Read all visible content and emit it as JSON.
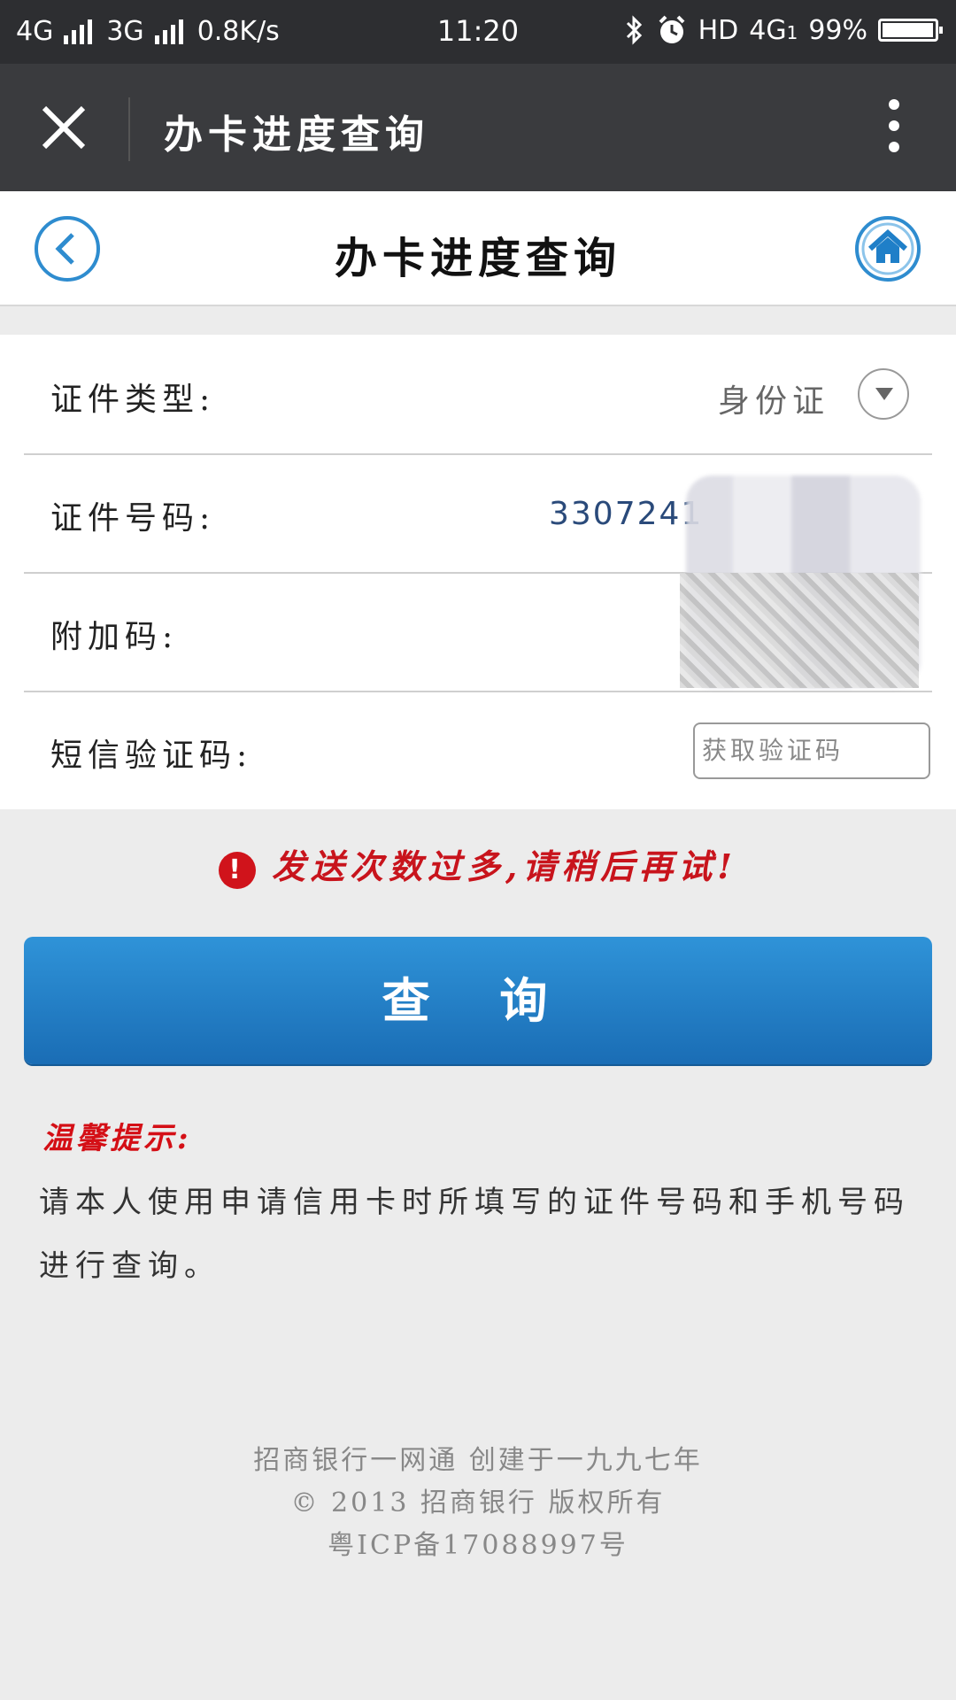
{
  "status_bar": {
    "net1": "4G",
    "net2": "3G",
    "speed": "0.8K/s",
    "time": "11:20",
    "hd": "HD",
    "net3": "4G",
    "sim": "1",
    "battery": "99%",
    "battery_level": 0.99
  },
  "titlebar": {
    "title": "办卡进度查询"
  },
  "header": {
    "title": "办卡进度查询"
  },
  "form": {
    "id_type_label": "证件类型:",
    "id_type_value": "身份证",
    "id_number_label": "证件号码:",
    "id_number_value": "3307241",
    "extra_code_label": "附加码:",
    "sms_label": "短信验证码:",
    "sms_button": "获取验证码"
  },
  "error": {
    "icon": "!",
    "message": "发送次数过多,请稍后再试!"
  },
  "query_button": "查 询",
  "tips": {
    "title": "温馨提示:",
    "text": "请本人使用申请信用卡时所填写的证件号码和手机号码进行查询。"
  },
  "footer": {
    "line1": "招商银行一网通 创建于一九九七年",
    "line2": "© 2013 招商银行 版权所有",
    "line3": "粤ICP备17088997号"
  },
  "colors": {
    "accent": "#1f7fc8",
    "error": "#c8141c",
    "titlebar": "#3a3b3e"
  }
}
